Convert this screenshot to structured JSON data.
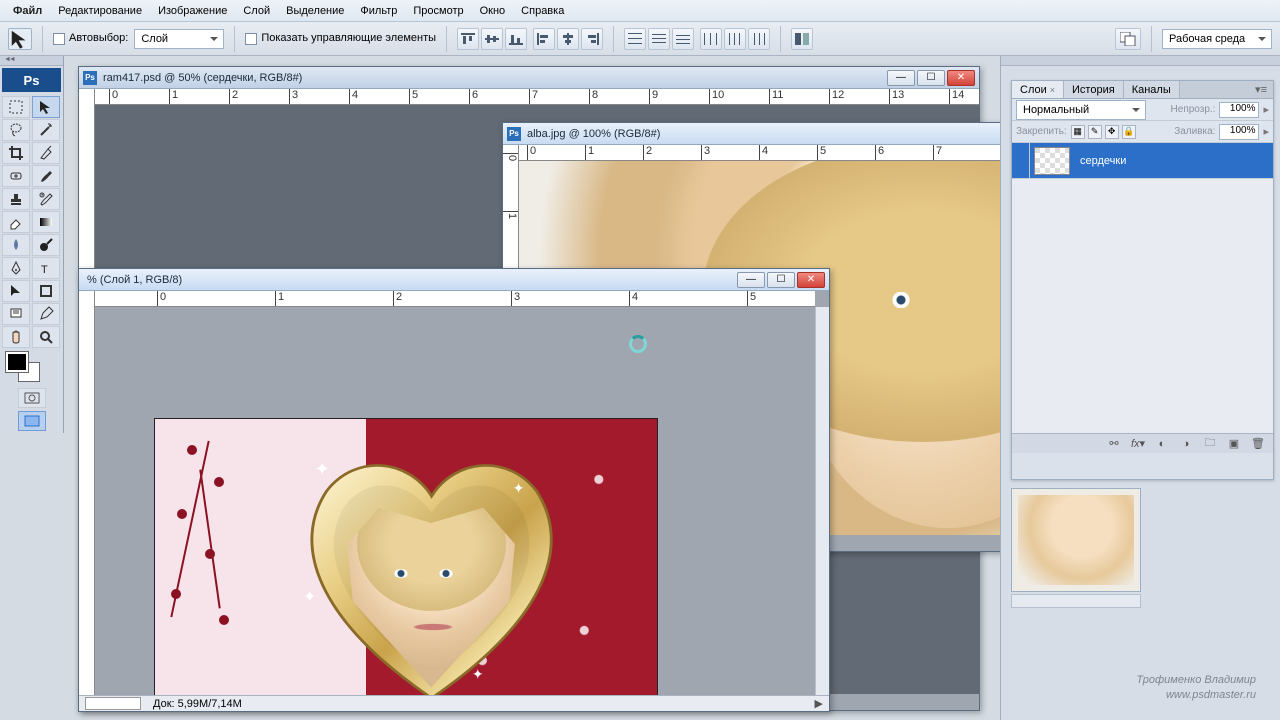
{
  "menu": {
    "items": [
      "Файл",
      "Редактирование",
      "Изображение",
      "Слой",
      "Выделение",
      "Фильтр",
      "Просмотр",
      "Окно",
      "Справка"
    ]
  },
  "options": {
    "autoSelectLabel": "Автовыбор:",
    "autoSelectTarget": "Слой",
    "showControlsLabel": "Показать управляющие элементы",
    "workspaceLabel": "Рабочая среда"
  },
  "docs": {
    "a": {
      "title": "ram417.psd @ 50% (сердечки, RGB/8#)"
    },
    "b": {
      "title": "alba.jpg @ 100% (RGB/8#)"
    },
    "c": {
      "title": "% (Слой 1, RGB/8)",
      "docSize": "Док: 5,99M/7,14M"
    }
  },
  "panels": {
    "tabs": {
      "layers": "Слои",
      "history": "История",
      "channels": "Каналы"
    },
    "blendMode": "Нормальный",
    "opacityLabel": "Непрозр.:",
    "opacityValue": "100%",
    "lockLabel": "Закрепить:",
    "fillLabel": "Заливка:",
    "fillValue": "100%",
    "layer1": "сердечки"
  },
  "watermark": {
    "line1": "Трофименко Владимир",
    "line2": "www.psdmaster.ru"
  }
}
